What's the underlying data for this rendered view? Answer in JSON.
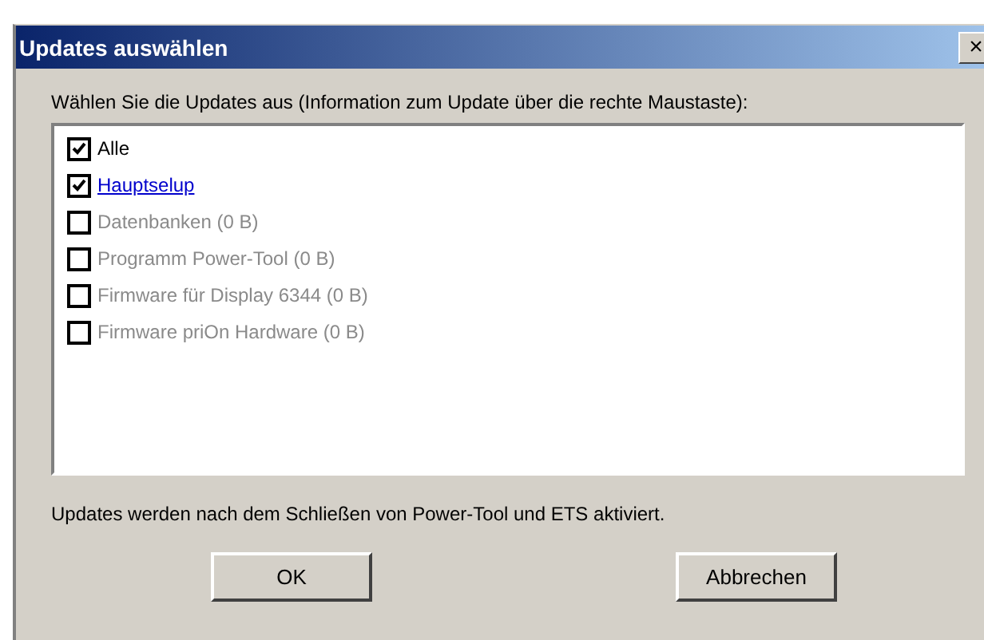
{
  "window": {
    "title": "Updates auswählen",
    "close": "×"
  },
  "prompt": "Wählen Sie die Updates aus (Information zum Update über die rechte Maustaste):",
  "items": [
    {
      "label": "Alle",
      "kind": "plain",
      "checked": true,
      "disabled": false
    },
    {
      "label": "Hauptselup",
      "kind": "link",
      "checked": true,
      "disabled": false
    },
    {
      "label": "Datenbanken (0 B)",
      "kind": "plain",
      "checked": false,
      "disabled": true
    },
    {
      "label": "Programm Power-Tool (0 B)",
      "kind": "plain",
      "checked": false,
      "disabled": true
    },
    {
      "label": "Firmware für Display 6344 (0 B)",
      "kind": "plain",
      "checked": false,
      "disabled": true
    },
    {
      "label": "Firmware priOn Hardware (0 B)",
      "kind": "plain",
      "checked": false,
      "disabled": true
    }
  ],
  "note": "Updates werden nach dem Schließen von Power-Tool und ETS aktiviert.",
  "buttons": [
    "OK",
    "Abbrechen"
  ]
}
